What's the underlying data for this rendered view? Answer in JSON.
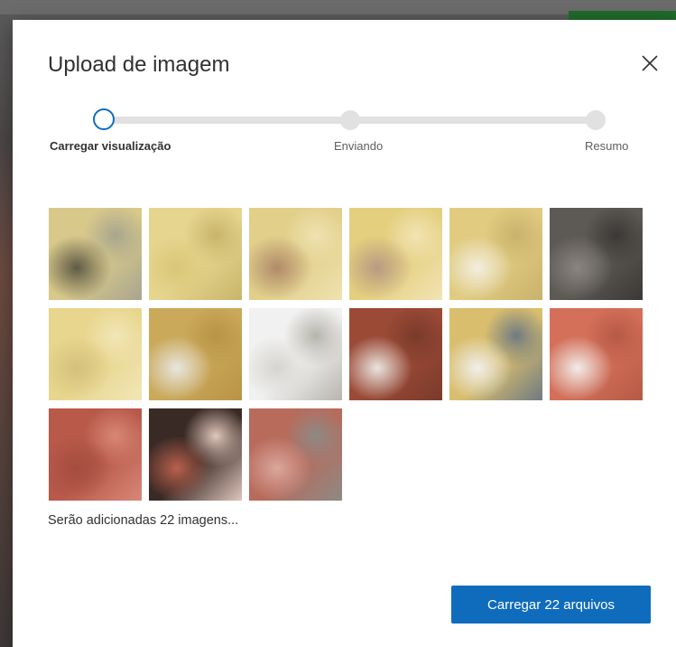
{
  "dialog": {
    "title": "Upload de imagem",
    "close_icon": "close-icon",
    "steps": [
      {
        "label": "Carregar visualização",
        "state": "active"
      },
      {
        "label": "Enviando",
        "state": "pending"
      },
      {
        "label": "Resumo",
        "state": "pending"
      }
    ],
    "thumbnails": [
      {
        "icon": "image-thumbnail",
        "colors": [
          "#d8c98a",
          "#5e5a46",
          "#a8a58f"
        ]
      },
      {
        "icon": "image-thumbnail",
        "colors": [
          "#e6d58e",
          "#d9c678",
          "#c8b56a"
        ]
      },
      {
        "icon": "image-thumbnail",
        "colors": [
          "#e1cf8a",
          "#b08a6a",
          "#f0e2b0"
        ]
      },
      {
        "icon": "image-thumbnail",
        "colors": [
          "#e3cf7e",
          "#b89a82",
          "#f2e4b4"
        ]
      },
      {
        "icon": "image-thumbnail",
        "colors": [
          "#e0cb80",
          "#f3eee0",
          "#c9b26c"
        ]
      },
      {
        "icon": "image-thumbnail",
        "colors": [
          "#5d5955",
          "#8a8580",
          "#3b3835"
        ]
      },
      {
        "icon": "image-thumbnail",
        "colors": [
          "#e8d68e",
          "#d4c07a",
          "#f1e6b6"
        ]
      },
      {
        "icon": "image-thumbnail",
        "colors": [
          "#caa95a",
          "#e8e6e0",
          "#b89445"
        ]
      },
      {
        "icon": "image-thumbnail",
        "colors": [
          "#f1f1f1",
          "#d6d4cf",
          "#b7b4ad"
        ]
      },
      {
        "icon": "image-thumbnail",
        "colors": [
          "#9b4a36",
          "#e9e5e0",
          "#7a3a2a"
        ]
      },
      {
        "icon": "image-thumbnail",
        "colors": [
          "#d9be6e",
          "#f0efec",
          "#6f7a82"
        ]
      },
      {
        "icon": "image-thumbnail",
        "colors": [
          "#d4705a",
          "#f1ede8",
          "#b55a45"
        ]
      },
      {
        "icon": "image-thumbnail",
        "colors": [
          "#b8594a",
          "#a44d3f",
          "#d88877"
        ]
      },
      {
        "icon": "image-thumbnail",
        "colors": [
          "#3a2a25",
          "#b8604d",
          "#e0c7bd"
        ]
      },
      {
        "icon": "image-thumbnail",
        "colors": [
          "#b86a5b",
          "#d9a79b",
          "#8d8a85"
        ]
      }
    ],
    "summary_text": "Serão adicionadas 22 imagens...",
    "primary_button_label": "Carregar 22 arquivos",
    "accent_color": "#0f6cbd"
  }
}
